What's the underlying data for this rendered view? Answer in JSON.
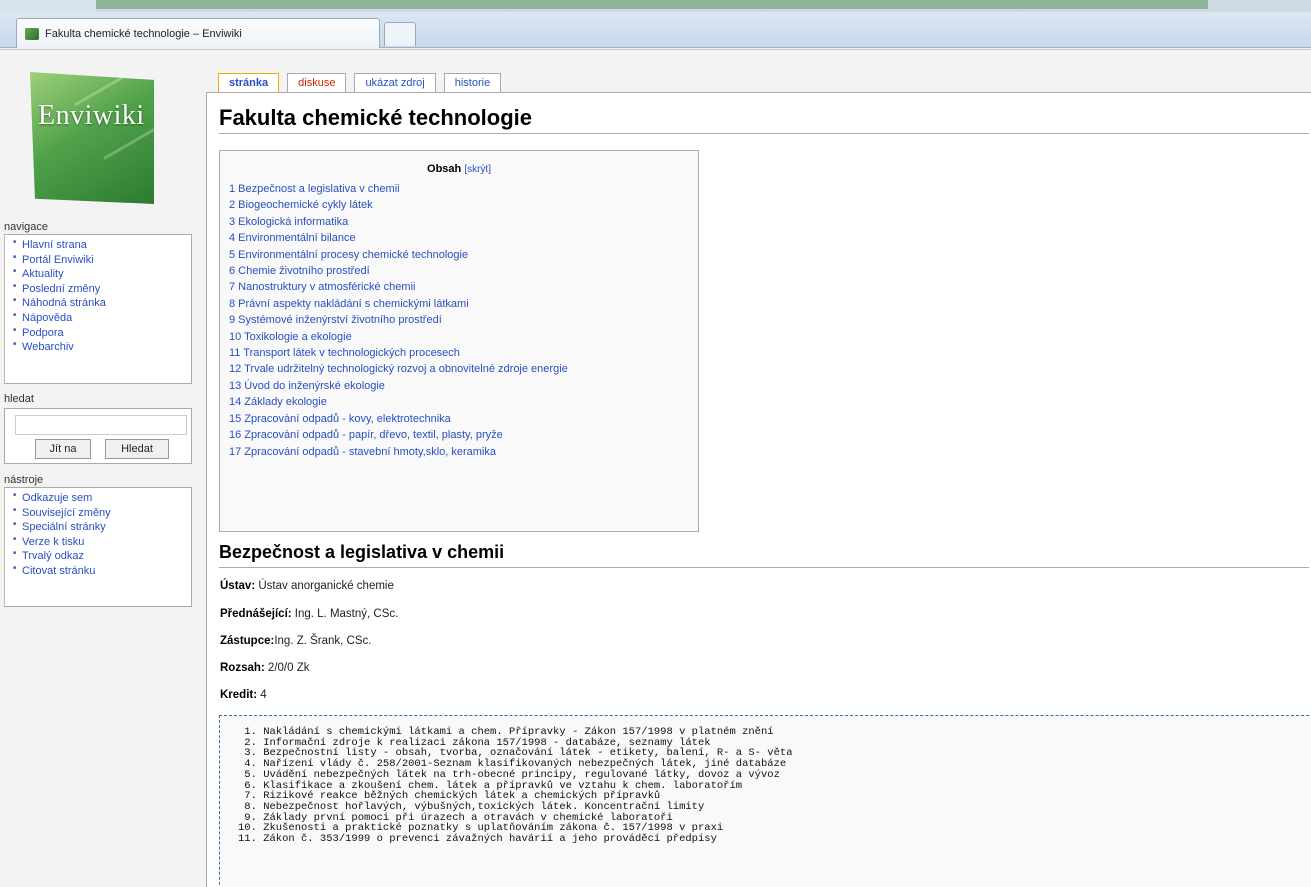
{
  "browser": {
    "tab_title": "Fakulta chemické technologie – Enviwiki"
  },
  "logo": {
    "text": "Enviwiki"
  },
  "sidebar": {
    "nav_title": "navigace",
    "nav_items": [
      "Hlavní strana",
      "Portál Enviwiki",
      "Aktuality",
      "Poslední změny",
      "Náhodná stránka",
      "Nápověda",
      "Podpora",
      "Webarchiv"
    ],
    "search_title": "hledat",
    "search_go": "Jít na",
    "search_button": "Hledat",
    "tools_title": "nástroje",
    "tools_items": [
      "Odkazuje sem",
      "Související změny",
      "Speciální stránky",
      "Verze k tisku",
      "Trvalý odkaz",
      "Citovat stránku"
    ]
  },
  "content_tabs": [
    "stránka",
    "diskuse",
    "ukázat zdroj",
    "historie"
  ],
  "page_title": "Fakulta chemické technologie",
  "toc": {
    "title": "Obsah",
    "hide": "[skrýt]",
    "items": [
      "1 Bezpečnost a legislativa v chemii",
      "2 Biogeochemické cykly látek",
      "3 Ekologická informatika",
      "4 Environmentální bilance",
      "5 Environmentální procesy chemické technologie",
      "6 Chemie životního prostředí",
      "7 Nanostruktury v atmosférické chemii",
      "8 Právní aspekty nakládání s chemickými látkami",
      "9 Systémové inženýrství životního prostředí",
      "10 Toxikologie a ekologie",
      "11 Transport látek v technologických procesech",
      "12 Trvale udržitelný technologický rozvoj a obnovitelné zdroje energie",
      "13 Úvod do inženýrské ekologie",
      "14 Základy ekologie",
      "15 Zpracování odpadů - kovy, elektrotechnika",
      "16 Zpracování odpadů - papír, dřevo, textil, plasty, pryže",
      "17 Zpracování odpadů - stavební hmoty,sklo, keramika"
    ]
  },
  "section": {
    "heading": "Bezpečnost a legislativa v chemii",
    "ustav_label": "Ústav:",
    "ustav_value": " Ústav anorganické chemie",
    "prednasejici_label": "Přednášející:",
    "prednasejici_value": " Ing. L. Mastný, CSc.",
    "zastupce_label": "Zástupce:",
    "zastupce_value": "Ing. Z. Šrank, CSc.",
    "rozsah_label": "Rozsah:",
    "rozsah_value": " 2/0/0 Zk",
    "kredit_label": "Kredit:",
    "kredit_value": " 4"
  },
  "syllabus": [
    " 1. Nakládání s chemickými látkami a chem. Přípravky - Zákon 157/1998 v platném znění",
    " 2. Informační zdroje k realizaci zákona 157/1998 - databáze, seznamy látek",
    " 3. Bezpečnostní listy - obsah, tvorba, označování látek - etikety, balení, R- a S- věta",
    " 4. Nařízení vlády č. 258/2001-Seznam klasifikovaných nebezpečných látek, jiné databáze",
    " 5. Uvádění nebezpečných látek na trh-obecné principy, regulované látky, dovoz a vývoz",
    " 6. Klasifikace a zkoušení chem. látek a přípravků ve vztahu k chem. laboratořím",
    " 7. Rizikové reakce běžných chemických látek a chemických přípravků",
    " 8. Nebezpečnost hořlavých, výbušných,toxických látek. Koncentrační limity",
    " 9. Základy první pomoci při úrazech a otravách v chemické laboratoři",
    "10. Zkušenosti a praktické poznatky s uplatňováním zákona č. 157/1998 v praxi",
    "11. Zákon č. 353/1999 o prevenci závažných havárií a jeho prováděcí předpisy"
  ]
}
